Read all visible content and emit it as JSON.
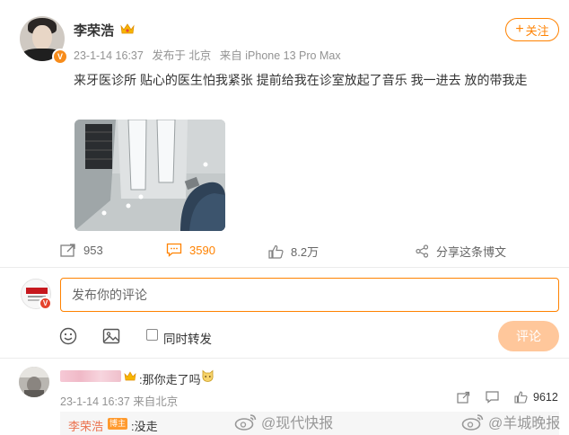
{
  "post": {
    "author": "李荣浩",
    "meta": {
      "time": "23-1-14 16:37",
      "location": "发布于 北京",
      "source": "来自 iPhone 13 Pro Max"
    },
    "follow_label": "关注",
    "text": "来牙医诊所 贴心的医生怕我紧张 提前给我在诊室放起了音乐 我一进去 放的带我走",
    "actions": {
      "repost_count": "953",
      "comment_count": "3590",
      "like_count": "8.2万",
      "share_label": "分享这条博文"
    }
  },
  "composer": {
    "placeholder": "发布你的评论",
    "repost_label": "同时转发",
    "submit_label": "评论"
  },
  "comments": [
    {
      "text": ":那你走了吗",
      "time": "23-1-14 16:37 来自北京",
      "like_count": "9612",
      "reply": {
        "author": "李荣浩",
        "badge": "博主",
        "text": ":没走"
      }
    }
  ],
  "watermarks": [
    "@现代快报",
    "@羊城晚报"
  ],
  "colors": {
    "accent": "#ff8200",
    "reply_name": "#eb7350",
    "submit_disabled": "#ffc79b"
  }
}
